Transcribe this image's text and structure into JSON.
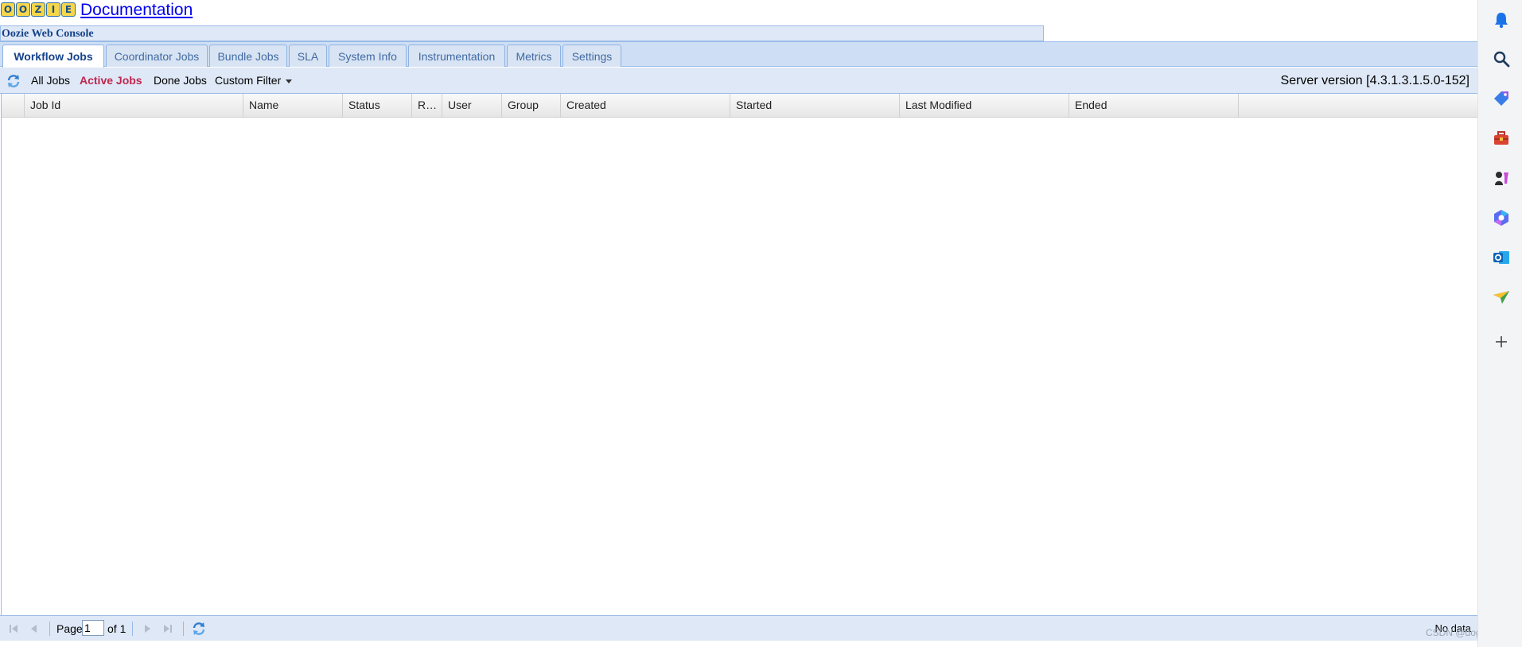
{
  "header": {
    "logo_letters": [
      "O",
      "O",
      "Z",
      "I",
      "E"
    ],
    "doc_link": "Documentation",
    "console_title": "Oozie Web Console"
  },
  "tabs": [
    {
      "label": "Workflow Jobs",
      "active": true
    },
    {
      "label": "Coordinator Jobs",
      "active": false
    },
    {
      "label": "Bundle Jobs",
      "active": false
    },
    {
      "label": "SLA",
      "active": false
    },
    {
      "label": "System Info",
      "active": false
    },
    {
      "label": "Instrumentation",
      "active": false
    },
    {
      "label": "Metrics",
      "active": false
    },
    {
      "label": "Settings",
      "active": false
    }
  ],
  "toolbar": {
    "filters": [
      {
        "label": "All Jobs",
        "active": false
      },
      {
        "label": "Active Jobs",
        "active": true
      },
      {
        "label": "Done Jobs",
        "active": false
      }
    ],
    "custom_filter": "Custom Filter",
    "server_version": "Server version [4.3.1.3.1.5.0-152]"
  },
  "grid": {
    "columns": [
      "Job Id",
      "Name",
      "Status",
      "R…",
      "User",
      "Group",
      "Created",
      "Started",
      "Last Modified",
      "Ended"
    ],
    "rows": []
  },
  "paging": {
    "page_label": "Page",
    "page_value": "1",
    "of_label": "of 1",
    "empty_message": "No data"
  },
  "watermark": "CSDN @dogplays",
  "sidebar": {
    "icons": [
      "bell-icon",
      "search-icon",
      "tag-icon",
      "toolbox-icon",
      "chess-icon",
      "copilot-icon",
      "outlook-icon",
      "send-icon",
      "plus-icon"
    ]
  },
  "colors": {
    "accent": "#15428b",
    "active_filter": "#c0264d",
    "panel_bg": "#dfe8f6",
    "border": "#99bbe8"
  }
}
